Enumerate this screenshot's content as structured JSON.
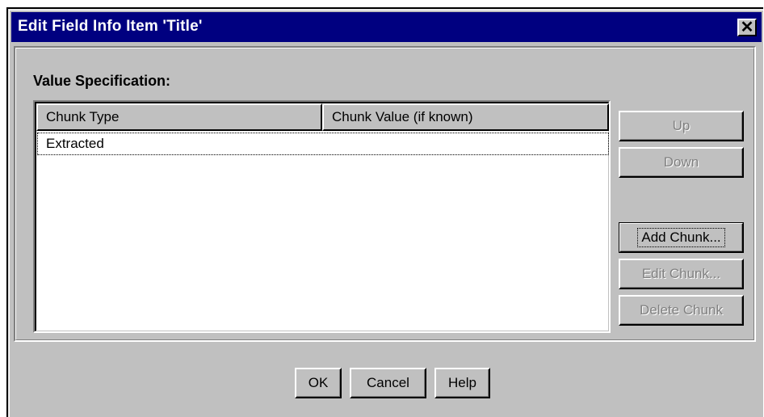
{
  "window": {
    "title": "Edit Field Info Item 'Title'",
    "close_glyph": "✕"
  },
  "section": {
    "label": "Value Specification:"
  },
  "table": {
    "columns": [
      "Chunk Type",
      "Chunk Value (if known)"
    ],
    "rows": [
      {
        "chunk_type": "Extracted",
        "chunk_value": ""
      }
    ]
  },
  "side_buttons": {
    "up": "Up",
    "down": "Down",
    "add_chunk": "Add Chunk...",
    "edit_chunk": "Edit Chunk...",
    "delete_chunk": "Delete Chunk"
  },
  "bottom_buttons": {
    "ok": "OK",
    "cancel": "Cancel",
    "help": "Help"
  },
  "colors": {
    "titlebar": "#000080",
    "face": "#c0c0c0",
    "disabled_text": "#808080"
  }
}
